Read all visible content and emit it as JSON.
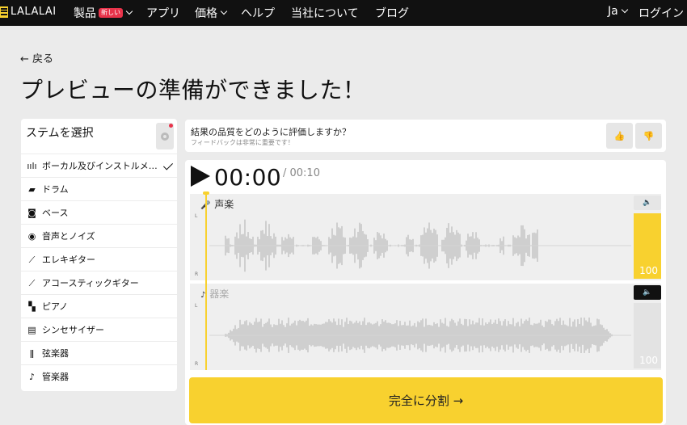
{
  "nav": {
    "logo": "LALALAI",
    "products": "製品",
    "badge_new": "新しい",
    "apps": "アプリ",
    "pricing": "価格",
    "help": "ヘルプ",
    "about": "当社について",
    "blog": "ブログ",
    "lang": "Ja",
    "login": "ログイン"
  },
  "page": {
    "back": "← 戻る",
    "title": "プレビューの準備ができました！"
  },
  "stems": {
    "title": "ステムを選択",
    "items": [
      {
        "label": "ボーカル及びインストルメ…",
        "icon": "waveform-icon",
        "glyph": "ıılı",
        "selected": true
      },
      {
        "label": "ドラム",
        "icon": "drum-icon",
        "glyph": "▰"
      },
      {
        "label": "ベース",
        "icon": "bass-amp-icon",
        "glyph": "◙"
      },
      {
        "label": "音声とノイズ",
        "icon": "microphone-icon",
        "glyph": "◉"
      },
      {
        "label": "エレキギター",
        "icon": "electric-guitar-icon",
        "glyph": "⟋"
      },
      {
        "label": "アコースティックギター",
        "icon": "acoustic-guitar-icon",
        "glyph": "⟋"
      },
      {
        "label": "ピアノ",
        "icon": "piano-icon",
        "glyph": "▚"
      },
      {
        "label": "シンセサイザー",
        "icon": "synthesizer-icon",
        "glyph": "▤"
      },
      {
        "label": "弦楽器",
        "icon": "harp-icon",
        "glyph": "ǁ"
      },
      {
        "label": "管楽器",
        "icon": "trumpet-icon",
        "glyph": "♪"
      }
    ]
  },
  "feedback": {
    "question": "結果の品質をどのように評価しますか？",
    "subtitle": "フィードバックは非常に重要です！",
    "up_glyph": "👍",
    "down_glyph": "👎"
  },
  "player": {
    "current_time": "00:00",
    "duration": "/ 00:10",
    "channel_l": "L",
    "channel_r": "R",
    "tracks": [
      {
        "label": "声楽",
        "icon": "microphone-icon",
        "glyph": "🎤",
        "volume": "100",
        "muted": false
      },
      {
        "label": "器楽",
        "icon": "music-note-icon",
        "glyph": "♪",
        "volume": "100",
        "muted": true
      }
    ],
    "speaker_glyph": "🔈",
    "split_button": "完全に分割 →"
  },
  "colors": {
    "accent": "#f8d12f",
    "nav_bg": "#111111",
    "page_bg": "#ebebeb",
    "waveform": "#cfcfcf",
    "badge": "#e8334a"
  }
}
